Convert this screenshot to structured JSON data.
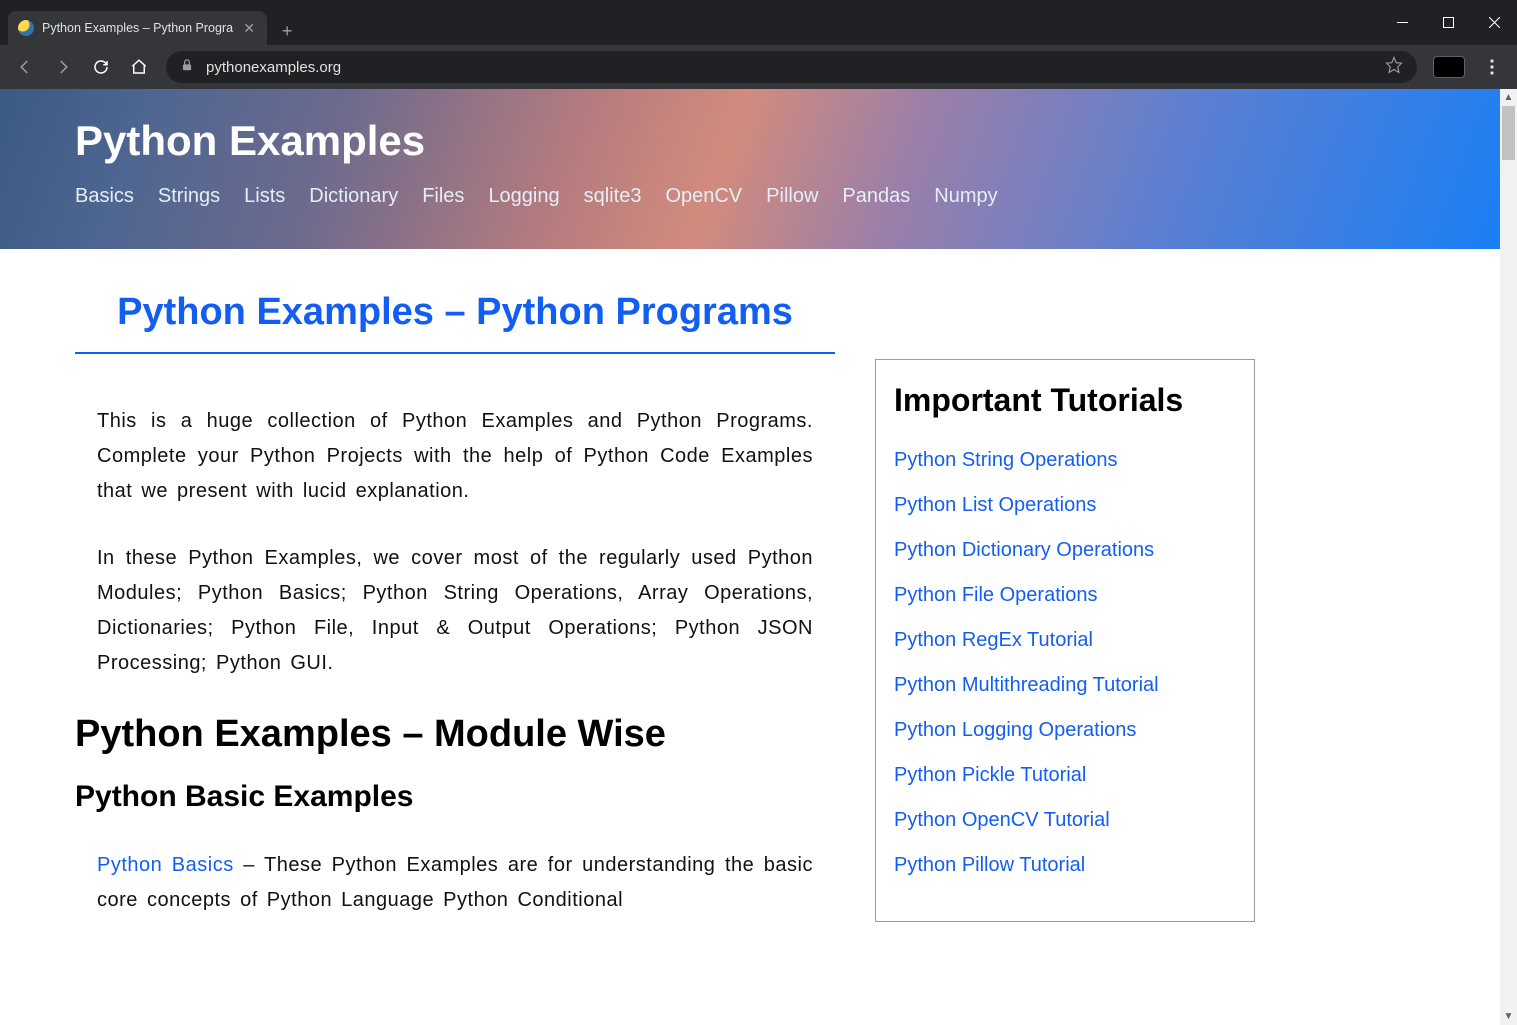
{
  "browser": {
    "tab_title": "Python Examples – Python Progra",
    "url": "pythonexamples.org"
  },
  "site": {
    "title": "Python Examples",
    "nav": [
      "Basics",
      "Strings",
      "Lists",
      "Dictionary",
      "Files",
      "Logging",
      "sqlite3",
      "OpenCV",
      "Pillow",
      "Pandas",
      "Numpy"
    ]
  },
  "article": {
    "h1": "Python Examples – Python Programs",
    "p1": "This is a huge collection of Python Examples and Python Programs. Complete your Python Projects with the help of Python Code Examples that we present with lucid explanation.",
    "p2": "In these Python Examples, we cover most of the regularly used Python Modules; Python Basics; Python String Operations, Array Operations, Dictionaries; Python File, Input & Output Operations; Python JSON Processing; Python GUI.",
    "h2": "Python Examples – Module Wise",
    "h3": "Python Basic Examples",
    "p3_link": "Python Basics",
    "p3_rest": " – These Python Examples are for understanding the basic core concepts of Python Language Python Conditional"
  },
  "sidebar": {
    "heading": "Important Tutorials",
    "links": [
      "Python String Operations",
      "Python List Operations",
      "Python Dictionary Operations",
      "Python File Operations",
      "Python RegEx Tutorial",
      "Python Multithreading Tutorial",
      "Python Logging Operations",
      "Python Pickle Tutorial",
      "Python OpenCV Tutorial",
      "Python Pillow Tutorial"
    ]
  }
}
